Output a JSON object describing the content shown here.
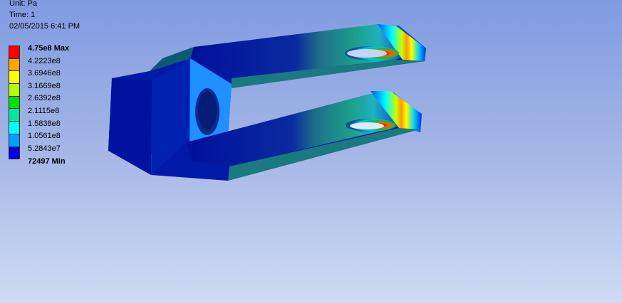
{
  "header": {
    "unit": "Unit: Pa",
    "time": "Time: 1",
    "date": "02/05/2015 6:41 PM"
  },
  "legend": {
    "max_label": "4.75e8 Max",
    "min_label": "72497 Min",
    "values": [
      "4.2223e8",
      "3.6946e8",
      "3.1669e8",
      "2.6392e8",
      "2.1115e8",
      "1.5838e8",
      "1.0561e8",
      "5.2843e7"
    ],
    "colors": [
      "#ff0000",
      "#ffa500",
      "#ffff00",
      "#b4ff00",
      "#00e000",
      "#00e8a0",
      "#00ffff",
      "#00a0ff",
      "#0000e0"
    ]
  }
}
